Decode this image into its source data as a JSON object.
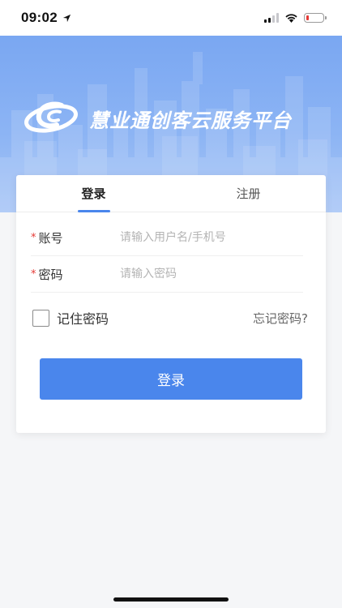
{
  "status_bar": {
    "time": "09:02",
    "location_icon": "location-arrow-icon",
    "signal_icon": "cellular-signal-icon",
    "wifi_icon": "wifi-icon",
    "battery_icon": "battery-low-icon",
    "battery_color": "#e53935"
  },
  "banner": {
    "logo_icon": "platform-logo-icon",
    "title": "慧业通创客云服务平台"
  },
  "tabs": [
    {
      "label": "登录",
      "active": true
    },
    {
      "label": "注册",
      "active": false
    }
  ],
  "form": {
    "account": {
      "required_mark": "*",
      "label": "账号",
      "placeholder": "请输入用户名/手机号",
      "value": ""
    },
    "password": {
      "required_mark": "*",
      "label": "密码",
      "placeholder": "请输入密码",
      "value": ""
    },
    "remember_label": "记住密码",
    "remember_checked": false,
    "forgot_label": "忘记密码?",
    "submit_label": "登录"
  },
  "colors": {
    "accent": "#4a86ec",
    "banner": "#8cb4f4",
    "required": "#e53935"
  }
}
